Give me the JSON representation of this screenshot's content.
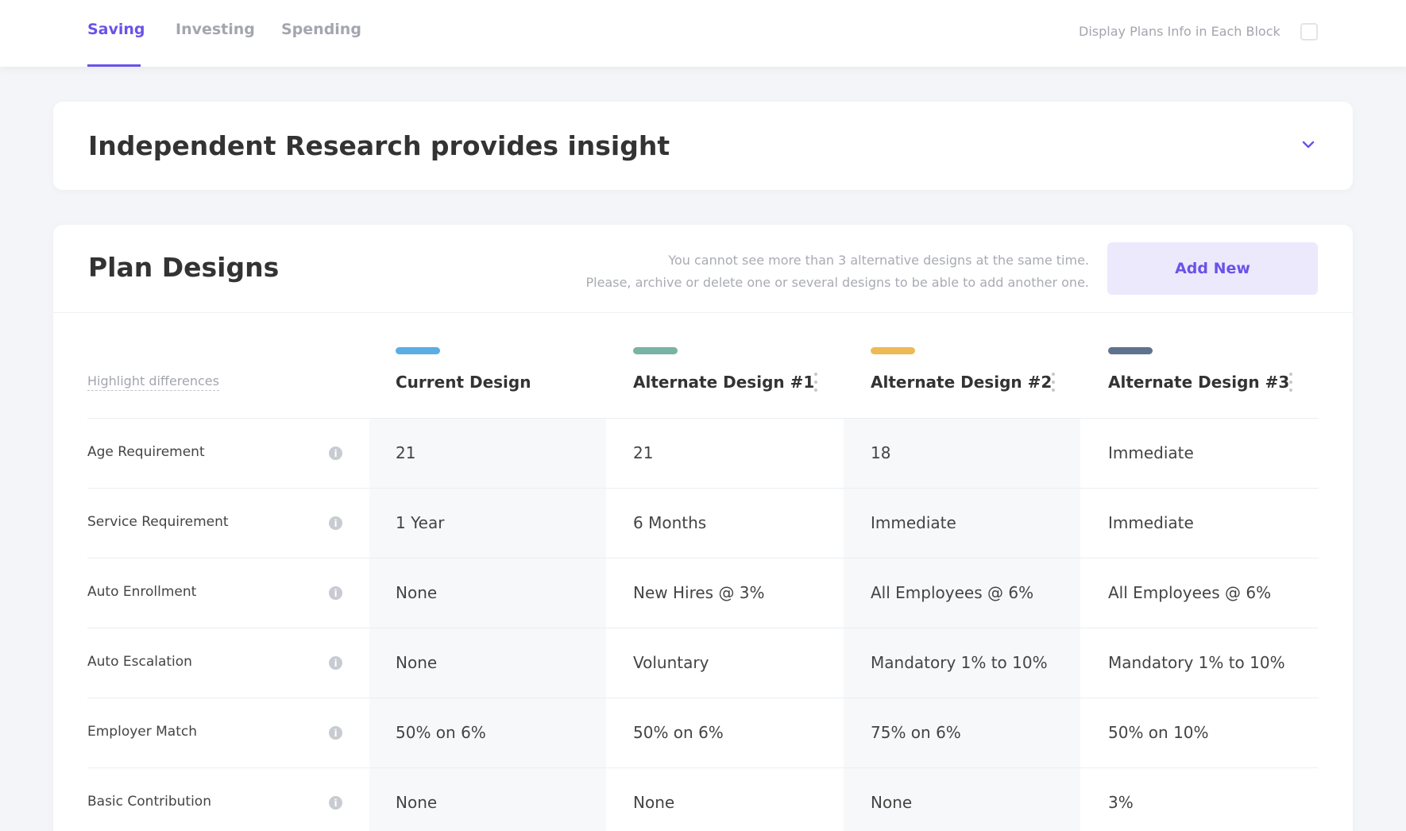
{
  "tabs": [
    {
      "label": "Saving",
      "active": true
    },
    {
      "label": "Investing",
      "active": false
    },
    {
      "label": "Spending",
      "active": false
    }
  ],
  "display_toggle": {
    "label": "Display Plans Info in Each Block",
    "checked": false
  },
  "research": {
    "title": "Independent Research provides insight",
    "icon": "chevron-down-icon"
  },
  "plans": {
    "title": "Plan Designs",
    "note_line1": "You cannot  see more than 3 alternative designs at the same time.",
    "note_line2": "Please, archive or delete one or several designs to be able to add another one.",
    "add_button": "Add New",
    "highlight_link": "Highlight differences",
    "columns": [
      {
        "title": "Current Design",
        "color": "#5aaee3",
        "menu": false
      },
      {
        "title": "Alternate Design #1",
        "color": "#78b3a5",
        "menu": true
      },
      {
        "title": "Alternate Design #2",
        "color": "#eeba55",
        "menu": true
      },
      {
        "title": "Alternate Design #3",
        "color": "#5f7391",
        "menu": true
      }
    ],
    "rows": [
      {
        "label": "Age Requirement",
        "values": [
          "21",
          "21",
          "18",
          "Immediate"
        ]
      },
      {
        "label": "Service Requirement",
        "values": [
          "1 Year",
          "6 Months",
          "Immediate",
          "Immediate"
        ]
      },
      {
        "label": "Auto Enrollment",
        "values": [
          "None",
          "New Hires @ 3%",
          "All Employees @ 6%",
          "All Employees @ 6%"
        ]
      },
      {
        "label": "Auto Escalation",
        "values": [
          "None",
          "Voluntary",
          "Mandatory 1% to 10%",
          "Mandatory 1% to 10%"
        ]
      },
      {
        "label": "Employer Match",
        "values": [
          "50% on 6%",
          "50% on 6%",
          "75% on 6%",
          "50% on 10%"
        ]
      },
      {
        "label": "Basic Contribution",
        "values": [
          "None",
          "None",
          "None",
          "3%"
        ]
      }
    ]
  },
  "colors": {
    "accent": "#6b52e8",
    "accent_light": "#ece9fd"
  }
}
